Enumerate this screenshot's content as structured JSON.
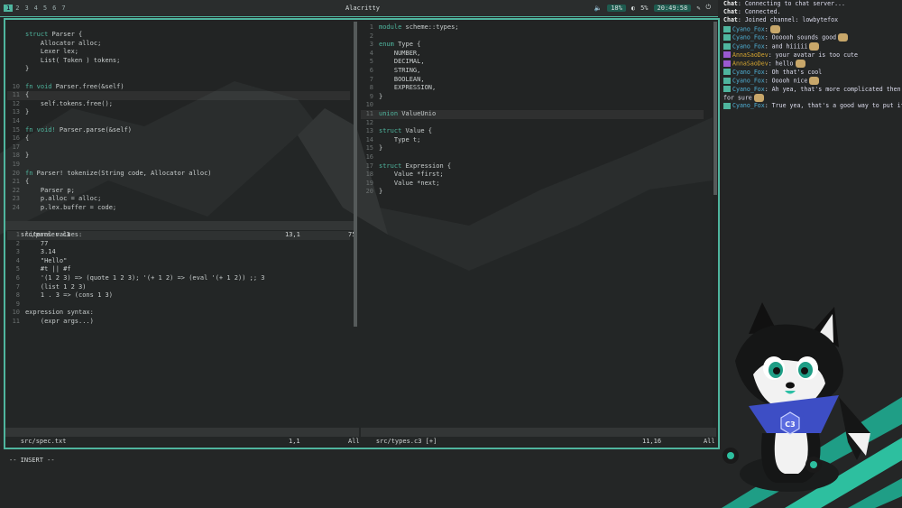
{
  "topbar": {
    "workspaces": [
      "1",
      "2",
      "3",
      "4",
      "5",
      "6",
      "7"
    ],
    "active_workspace": "1",
    "title": "Alacritty",
    "volume": "18%",
    "brightness": "5%",
    "clock": "20:49:58"
  },
  "editor": {
    "left_top": {
      "lines": [
        {
          "n": "",
          "t": "struct Parser {",
          "kw": "struct"
        },
        {
          "n": "",
          "t": "    Allocator alloc;"
        },
        {
          "n": "",
          "t": "    Lexer lex;"
        },
        {
          "n": "",
          "t": "    List( Token ) tokens;"
        },
        {
          "n": "",
          "t": "}"
        },
        {
          "n": "",
          "t": ""
        },
        {
          "n": "10",
          "t": "fn void Parser.free(&self)",
          "kw": "fn void"
        },
        {
          "n": "11",
          "t": "{"
        },
        {
          "n": "12",
          "t": "    self.tokens.free();"
        },
        {
          "n": "13",
          "t": "}"
        },
        {
          "n": "14",
          "t": ""
        },
        {
          "n": "15",
          "t": "fn void! Parser.parse(&self)",
          "kw": "fn void!"
        },
        {
          "n": "16",
          "t": "{"
        },
        {
          "n": "17",
          "t": ""
        },
        {
          "n": "18",
          "t": "}"
        },
        {
          "n": "19",
          "t": ""
        },
        {
          "n": "20",
          "t": "fn Parser! tokenize(String code, Allocator alloc)",
          "kw": "fn"
        },
        {
          "n": "21",
          "t": "{"
        },
        {
          "n": "22",
          "t": "    Parser p;"
        },
        {
          "n": "23",
          "t": "    p.alloc = alloc;"
        },
        {
          "n": "24",
          "t": "    p.lex.buffer = code;"
        }
      ],
      "status_file": "src/parser.c3",
      "status_pos": "13,1",
      "status_pct": "75"
    },
    "left_bottom": {
      "lines": [
        {
          "n": "1",
          "t": "literal values:"
        },
        {
          "n": "2",
          "t": "    77"
        },
        {
          "n": "3",
          "t": "    3.14"
        },
        {
          "n": "4",
          "t": "    \"Hello\""
        },
        {
          "n": "5",
          "t": "    #t || #f"
        },
        {
          "n": "6",
          "t": "    '(1 2 3) => (quote 1 2 3); '(+ 1 2) => (eval '(+ 1 2)) ;; 3"
        },
        {
          "n": "7",
          "t": "    (list 1 2 3)"
        },
        {
          "n": "8",
          "t": "    1 . 3 => (cons 1 3)"
        },
        {
          "n": "9",
          "t": ""
        },
        {
          "n": "10",
          "t": "expression syntax:"
        },
        {
          "n": "11",
          "t": "    (expr args...)"
        }
      ],
      "status_file": "src/spec.txt",
      "status_pos": "1,1",
      "status_pct": "All"
    },
    "right": {
      "lines": [
        {
          "n": "1",
          "t": "module scheme::types;",
          "kw": "module"
        },
        {
          "n": "2",
          "t": ""
        },
        {
          "n": "3",
          "t": "enum Type {",
          "kw": "enum"
        },
        {
          "n": "4",
          "t": "    NUMBER,"
        },
        {
          "n": "5",
          "t": "    DECIMAL,"
        },
        {
          "n": "6",
          "t": "    STRING,"
        },
        {
          "n": "7",
          "t": "    BOOLEAN,"
        },
        {
          "n": "8",
          "t": "    EXPRESSION,"
        },
        {
          "n": "9",
          "t": "}"
        },
        {
          "n": "10",
          "t": ""
        },
        {
          "n": "11",
          "t": "union ValueUnio",
          "kw": "union"
        },
        {
          "n": "12",
          "t": ""
        },
        {
          "n": "13",
          "t": "struct Value {",
          "kw": "struct"
        },
        {
          "n": "14",
          "t": "    Type t;"
        },
        {
          "n": "15",
          "t": "}"
        },
        {
          "n": "16",
          "t": ""
        },
        {
          "n": "17",
          "t": "struct Expression {",
          "kw": "struct"
        },
        {
          "n": "18",
          "t": "    Value *first;"
        },
        {
          "n": "19",
          "t": "    Value *next;"
        },
        {
          "n": "20",
          "t": "}"
        }
      ],
      "status_file": "src/types.c3 [+]",
      "status_pos": "11,16",
      "status_pct": "All"
    },
    "mode": "-- INSERT --"
  },
  "chat": {
    "messages": [
      {
        "user": "Chat",
        "text": ": Connecting to chat server...",
        "kind": "sys"
      },
      {
        "user": "Chat",
        "text": ": Connected.",
        "kind": "sys"
      },
      {
        "user": "Chat",
        "text": ": Joined channel: lowbytefox",
        "kind": "sys"
      },
      {
        "user": "Cyano_Fox",
        "text": ":",
        "kind": "u",
        "emote": true
      },
      {
        "user": "Cyano_Fox",
        "text": ": Oooooh sounds good",
        "kind": "u",
        "emote": true
      },
      {
        "user": "Cyano_Fox",
        "text": ": and hiiiii",
        "kind": "u",
        "emote": true
      },
      {
        "user": "AnnaSaoDev",
        "text": ": your avatar is too cute",
        "kind": "u2"
      },
      {
        "user": "AnnaSaoDev",
        "text": ": hello",
        "kind": "u2",
        "emote": true
      },
      {
        "user": "Cyano_Fox",
        "text": ": Oh that's cool",
        "kind": "u"
      },
      {
        "user": "Cyano_Fox",
        "text": ": Ooooh nice",
        "kind": "u",
        "emote": true
      },
      {
        "user": "Cyano_Fox",
        "text": ": Ah yea, that's more complicated then",
        "kind": "u"
      },
      {
        "user": "",
        "text": "for sure",
        "kind": "cont",
        "emote": true
      },
      {
        "user": "Cyano_Fox",
        "text": ": True yea, that's a good way to put it",
        "kind": "u"
      }
    ]
  },
  "mascot": {
    "badge_text": "C3"
  }
}
